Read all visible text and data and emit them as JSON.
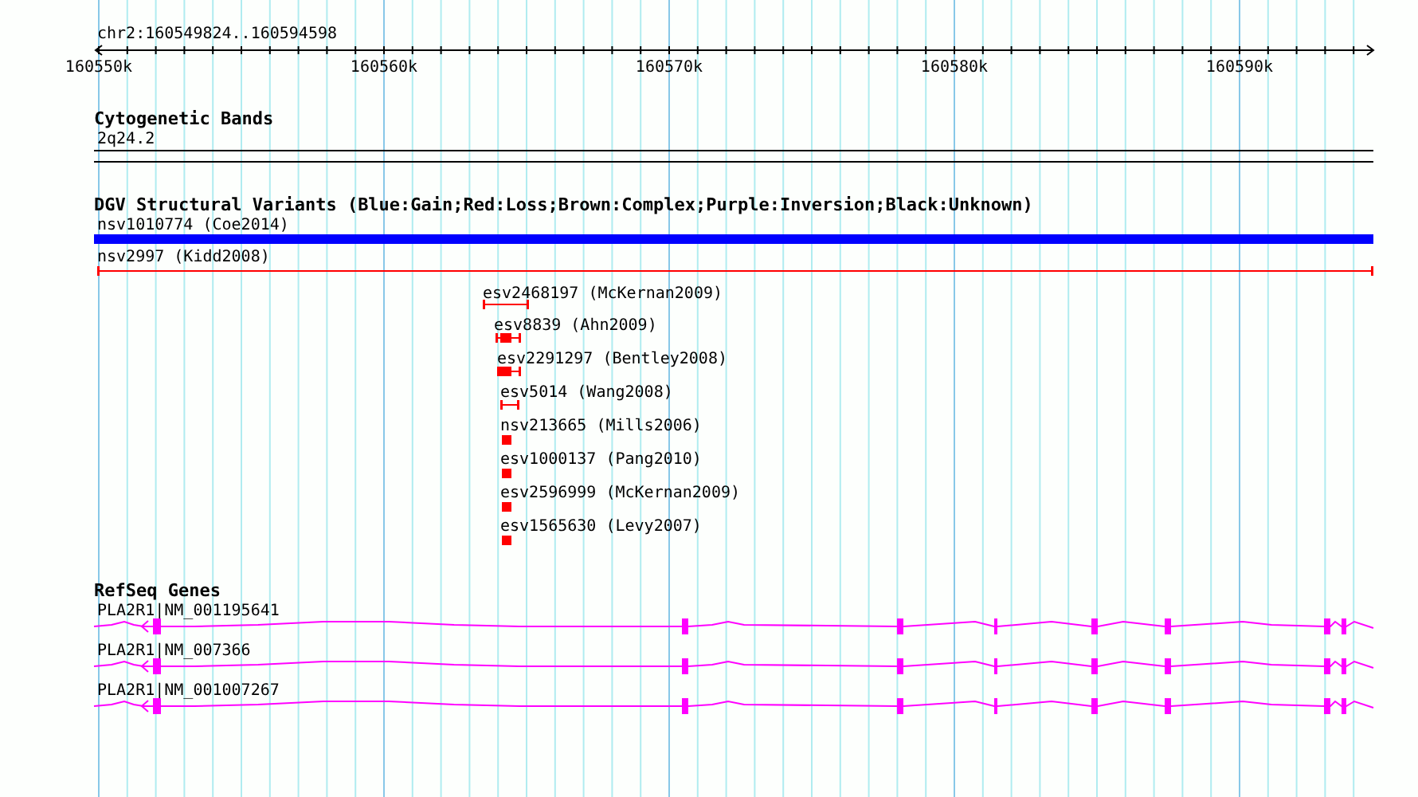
{
  "ruler": {
    "region": "chr2:160549824..160594598",
    "tick_labels": [
      "160550k",
      "160560k",
      "160570k",
      "160580k",
      "160590k"
    ]
  },
  "tracks": [
    {
      "kind": "cytoband",
      "title": "Cytogenetic Bands",
      "features": [
        {
          "label": "2q24.2"
        }
      ]
    },
    {
      "kind": "variants",
      "title": "DGV Structural Variants (Blue:Gain;Red:Loss;Brown:Complex;Purple:Inversion;Black:Unknown)",
      "features": [
        {
          "label": "nsv1010774 (Coe2014)",
          "color": "#0000ff"
        },
        {
          "label": "nsv2997 (Kidd2008)",
          "color": "#ff0000"
        },
        {
          "label": "esv2468197 (McKernan2009)",
          "color": "#ff0000"
        },
        {
          "label": "esv8839 (Ahn2009)",
          "color": "#ff0000"
        },
        {
          "label": "esv2291297 (Bentley2008)",
          "color": "#ff0000"
        },
        {
          "label": "esv5014 (Wang2008)",
          "color": "#ff0000"
        },
        {
          "label": "nsv213665 (Mills2006)",
          "color": "#ff0000"
        },
        {
          "label": "esv1000137 (Pang2010)",
          "color": "#ff0000"
        },
        {
          "label": "esv2596999 (McKernan2009)",
          "color": "#ff0000"
        },
        {
          "label": "esv1565630 (Levy2007)",
          "color": "#ff0000"
        }
      ]
    },
    {
      "kind": "genes",
      "title": "RefSeq Genes",
      "features": [
        {
          "label": "PLA2R1|NM_001195641"
        },
        {
          "label": "PLA2R1|NM_007366"
        },
        {
          "label": "PLA2R1|NM_001007267"
        }
      ]
    }
  ]
}
